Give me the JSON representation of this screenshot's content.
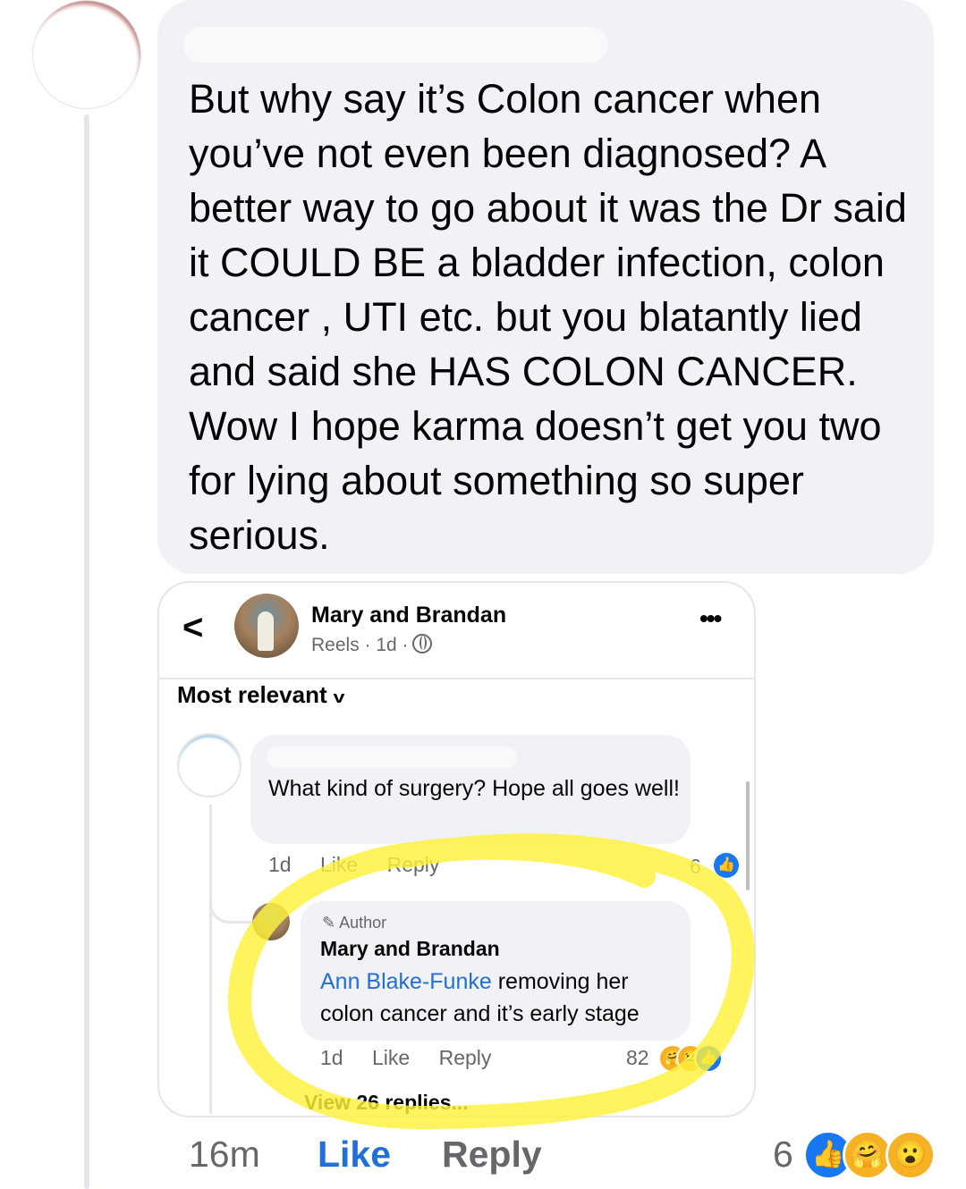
{
  "outer_comment": {
    "text": "But why say it’s Colon cancer when you’ve not even been diagnosed? A better way to go about it was the Dr said it COULD BE a bladder infection, colon cancer , UTI etc. but you blatantly lied and said she HAS COLON CANCER. Wow I hope karma doesn’t get you two for lying about something so super serious.",
    "time": "16m",
    "like_label": "Like",
    "reply_label": "Reply",
    "reaction_count": "6",
    "reactions": [
      "like-icon",
      "care-icon",
      "wow-icon"
    ]
  },
  "embedded": {
    "page_name": "Mary and Brandan",
    "meta": "Reels · 1d ·",
    "sort_label": "Most relevant",
    "comment": {
      "text": "What kind of surgery?  Hope all goes well!",
      "time": "1d",
      "like_label": "Like",
      "reply_label": "Reply",
      "reaction_count": "6"
    },
    "reply": {
      "badge": "Author",
      "name": "Mary and Brandan",
      "mention": "Ann Blake-Funke",
      "text": " removing her colon cancer and it’s early stage",
      "time": "1d",
      "like_label": "Like",
      "reply_label": "Reply",
      "reaction_count": "82"
    },
    "view_replies": "View 26 replies..."
  },
  "colors": {
    "link_blue": "#216fdb",
    "bubble_gray": "#f0f2f5",
    "muted_text": "#65676b",
    "highlight_yellow": "#fff23a"
  }
}
